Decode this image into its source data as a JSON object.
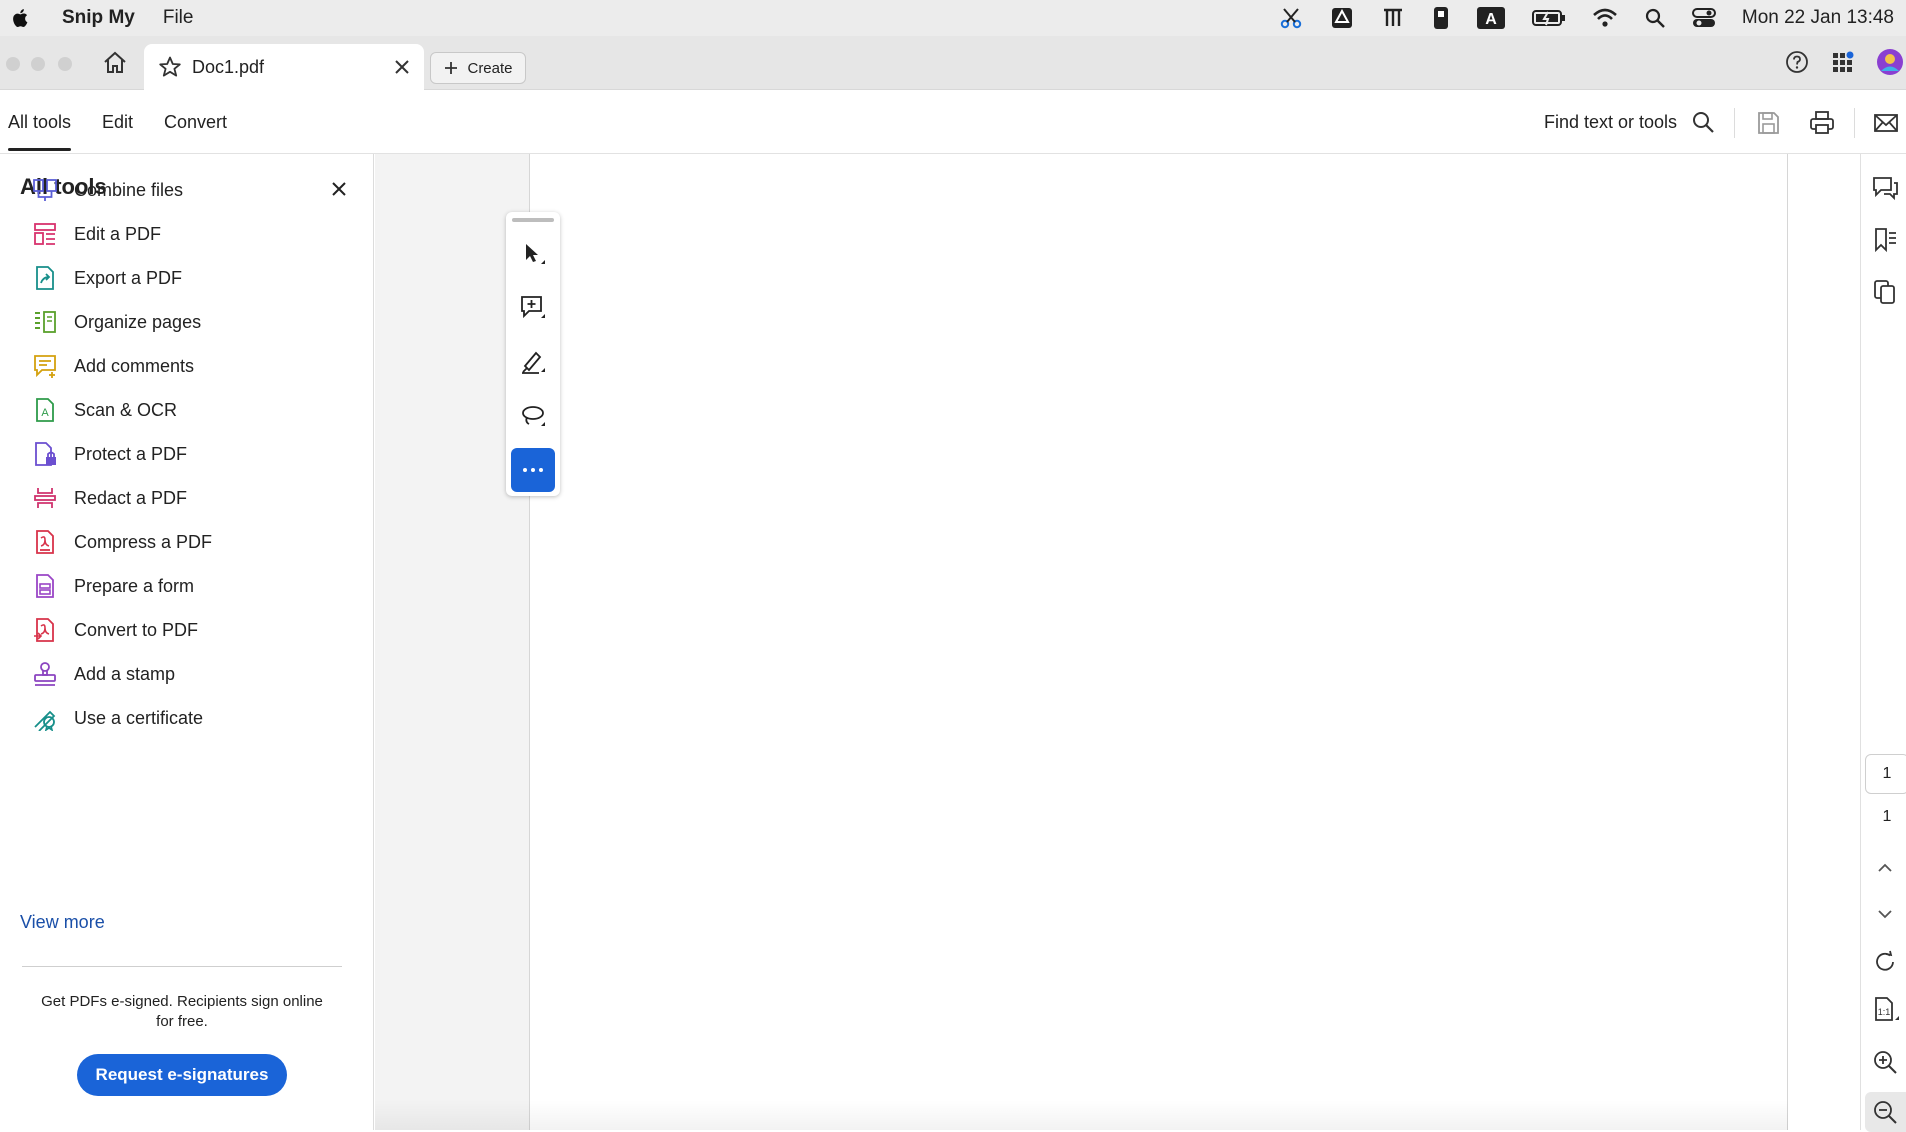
{
  "menubar": {
    "app_name": "Snip My",
    "file_menu": "File",
    "clock": "Mon 22 Jan  13:48"
  },
  "tabbar": {
    "doc_tab_name": "Doc1.pdf",
    "create_label": "Create"
  },
  "toolbar": {
    "tabs": [
      "All tools",
      "Edit",
      "Convert"
    ],
    "find_label": "Find text or tools"
  },
  "panel": {
    "title": "All tools",
    "tools": [
      {
        "label": "Combine files",
        "color": "#5b5fd6"
      },
      {
        "label": "Edit a PDF",
        "color": "#d8336e"
      },
      {
        "label": "Export a PDF",
        "color": "#178f8a"
      },
      {
        "label": "Organize pages",
        "color": "#5aa02c"
      },
      {
        "label": "Add comments",
        "color": "#d4a10e"
      },
      {
        "label": "Scan & OCR",
        "color": "#2e9b4a"
      },
      {
        "label": "Protect a PDF",
        "color": "#6b4fd0"
      },
      {
        "label": "Redact a PDF",
        "color": "#d0336e"
      },
      {
        "label": "Compress a PDF",
        "color": "#d8334a"
      },
      {
        "label": "Prepare a form",
        "color": "#9a46c6"
      },
      {
        "label": "Convert to PDF",
        "color": "#d8334a"
      },
      {
        "label": "Add a stamp",
        "color": "#8b44c0"
      },
      {
        "label": "Use a certificate",
        "color": "#178f8a"
      }
    ],
    "view_more": "View more",
    "promo_text": "Get PDFs e-signed. Recipients sign online for free.",
    "request_button": "Request e-signatures"
  },
  "rightrail": {
    "current_page": "1",
    "total_pages": "1"
  },
  "colors": {
    "accent": "#1a64d8",
    "link": "#1a4fa8"
  }
}
